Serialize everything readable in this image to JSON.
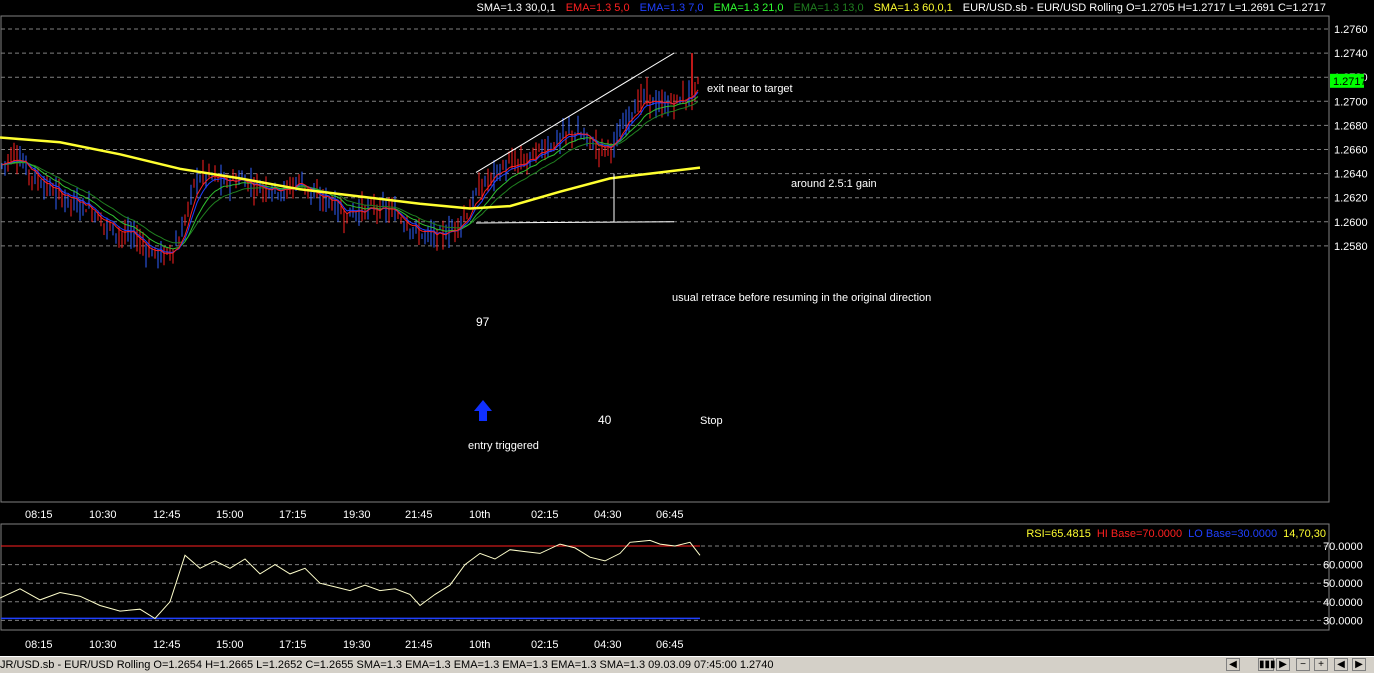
{
  "header": {
    "indicators": [
      {
        "label": "SMA=1.3  30,0,1",
        "color": "#ffffff"
      },
      {
        "label": "EMA=1.3  5,0",
        "color": "#ff2020"
      },
      {
        "label": "EMA=1.3  7,0",
        "color": "#2040ff"
      },
      {
        "label": "EMA=1.3  21,0",
        "color": "#30ff30"
      },
      {
        "label": "EMA=1.3  13,0",
        "color": "#208020"
      },
      {
        "label": "SMA=1.3  60,0,1",
        "color": "#ffff30"
      },
      {
        "label": "EUR/USD.sb - EUR/USD Rolling O=1.2705 H=1.2717 L=1.2691 C=1.2717",
        "color": "#ffffff"
      }
    ]
  },
  "price_axis": {
    "labels": [
      "1.2760",
      "1.2740",
      "1.2720",
      "1.2700",
      "1.2680",
      "1.2660",
      "1.2640",
      "1.2620",
      "1.2600",
      "1.2580"
    ],
    "current_price": "1.2717"
  },
  "time_axis": [
    "08:15",
    "10:30",
    "12:45",
    "15:00",
    "17:15",
    "19:30",
    "21:45",
    "10th",
    "02:15",
    "04:30",
    "06:45"
  ],
  "annotations": {
    "exit": "exit near to target",
    "gain": "around 2.5:1 gain",
    "retrace": "usual retrace before resuming in the original direction",
    "stop": "Stop",
    "entry": "entry triggered",
    "pips_97": "97",
    "pips_40": "40"
  },
  "rsi_panel": {
    "header": [
      {
        "label": "RSI=65.4815",
        "color": "#ffff30"
      },
      {
        "label": "HI Base=70.0000",
        "color": "#ff2020"
      },
      {
        "label": "LO Base=30.0000",
        "color": "#2040ff"
      },
      {
        "label": "14,70,30",
        "color": "#ffff30"
      }
    ],
    "axis_labels": [
      "70.0000",
      "60.0000",
      "50.0000",
      "40.0000",
      "30.0000"
    ]
  },
  "status_bar": {
    "text": "JR/USD.sb - EUR/USD Rolling O=1.2654 H=1.2665 L=1.2652 C=1.2655  SMA=1.3 EMA=1.3 EMA=1.3 EMA=1.3 EMA=1.3 SMA=1.3  09.03.09 07:45:00 1.2740",
    "buttons": [
      "◀",
      "▮▮▮",
      "▶",
      "−",
      "+",
      "◀",
      "▶"
    ]
  },
  "chart_data": {
    "type": "candlestick",
    "symbol": "EUR/USD",
    "ylim": [
      1.2562,
      1.277
    ],
    "price_path": [
      [
        0,
        1.2645
      ],
      [
        15,
        1.2658
      ],
      [
        30,
        1.264
      ],
      [
        45,
        1.263
      ],
      [
        60,
        1.2622
      ],
      [
        75,
        1.2615
      ],
      [
        90,
        1.2612
      ],
      [
        105,
        1.2598
      ],
      [
        120,
        1.259
      ],
      [
        135,
        1.2588
      ],
      [
        150,
        1.2575
      ],
      [
        165,
        1.2572
      ],
      [
        180,
        1.2585
      ],
      [
        195,
        1.2635
      ],
      [
        210,
        1.264
      ],
      [
        225,
        1.2632
      ],
      [
        240,
        1.2636
      ],
      [
        255,
        1.263
      ],
      [
        270,
        1.2628
      ],
      [
        285,
        1.2625
      ],
      [
        300,
        1.2635
      ],
      [
        315,
        1.262
      ],
      [
        330,
        1.2618
      ],
      [
        345,
        1.2605
      ],
      [
        360,
        1.261
      ],
      [
        375,
        1.2612
      ],
      [
        390,
        1.261
      ],
      [
        405,
        1.26
      ],
      [
        420,
        1.259
      ],
      [
        435,
        1.2588
      ],
      [
        450,
        1.2592
      ],
      [
        465,
        1.2605
      ],
      [
        480,
        1.2628
      ],
      [
        495,
        1.264
      ],
      [
        510,
        1.2648
      ],
      [
        525,
        1.265
      ],
      [
        540,
        1.266
      ],
      [
        555,
        1.2665
      ],
      [
        570,
        1.2675
      ],
      [
        585,
        1.267
      ],
      [
        600,
        1.266
      ],
      [
        615,
        1.2665
      ],
      [
        630,
        1.269
      ],
      [
        645,
        1.2705
      ],
      [
        660,
        1.2695
      ],
      [
        675,
        1.27
      ],
      [
        690,
        1.2705
      ],
      [
        700,
        1.2717
      ]
    ],
    "sma60_path": [
      [
        0,
        1.267
      ],
      [
        60,
        1.2666
      ],
      [
        120,
        1.2656
      ],
      [
        180,
        1.2644
      ],
      [
        240,
        1.2636
      ],
      [
        300,
        1.2627
      ],
      [
        360,
        1.2621
      ],
      [
        420,
        1.2615
      ],
      [
        470,
        1.2611
      ],
      [
        510,
        1.2613
      ],
      [
        560,
        1.2625
      ],
      [
        610,
        1.2636
      ],
      [
        650,
        1.264
      ],
      [
        700,
        1.2645
      ]
    ],
    "rsi_path": [
      [
        0,
        42
      ],
      [
        20,
        47
      ],
      [
        40,
        41
      ],
      [
        60,
        45
      ],
      [
        80,
        43
      ],
      [
        100,
        38
      ],
      [
        120,
        35
      ],
      [
        140,
        36
      ],
      [
        155,
        31
      ],
      [
        170,
        40
      ],
      [
        185,
        65
      ],
      [
        200,
        58
      ],
      [
        215,
        62
      ],
      [
        230,
        58
      ],
      [
        245,
        63
      ],
      [
        260,
        55
      ],
      [
        275,
        60
      ],
      [
        290,
        55
      ],
      [
        305,
        58
      ],
      [
        320,
        50
      ],
      [
        335,
        48
      ],
      [
        350,
        46
      ],
      [
        365,
        49
      ],
      [
        380,
        46
      ],
      [
        395,
        47
      ],
      [
        410,
        44
      ],
      [
        420,
        38
      ],
      [
        435,
        44
      ],
      [
        450,
        49
      ],
      [
        465,
        60
      ],
      [
        480,
        66
      ],
      [
        495,
        63
      ],
      [
        510,
        68
      ],
      [
        525,
        67
      ],
      [
        540,
        66
      ],
      [
        560,
        71
      ],
      [
        575,
        69
      ],
      [
        590,
        64
      ],
      [
        605,
        62
      ],
      [
        620,
        66
      ],
      [
        630,
        72
      ],
      [
        650,
        73
      ],
      [
        660,
        71
      ],
      [
        675,
        70
      ],
      [
        690,
        72
      ],
      [
        700,
        65
      ]
    ],
    "rsi_levels": {
      "hi": 70,
      "lo": 30
    },
    "rsi_ylim": [
      25,
      75
    ],
    "trade": {
      "entry": 1.2599,
      "stop": 1.26,
      "target": 1.274,
      "pullback_high": 1.264
    }
  }
}
